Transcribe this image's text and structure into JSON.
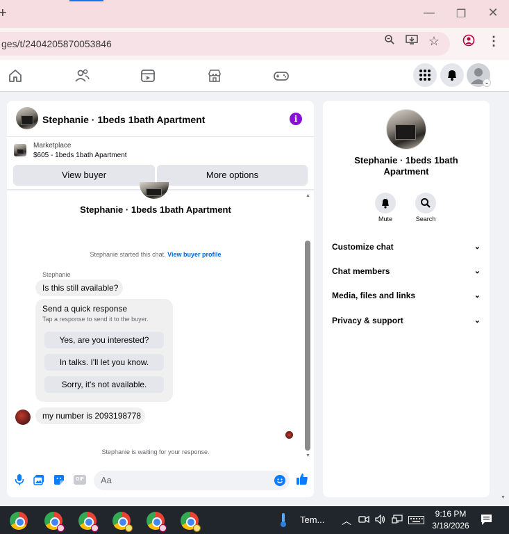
{
  "browser": {
    "url": "ges/t/2404205870053846",
    "new_tab_glyph": "+"
  },
  "chat": {
    "header_title": "Stephanie · 1beds 1bath Apartment",
    "marketplace_label": "Marketplace",
    "listing_line": "$605 - 1beds 1bath Apartment",
    "view_buyer": "View buyer",
    "more_options": "More options",
    "center_title": "Stephanie · 1beds 1bath Apartment",
    "started_text": "Stephanie started this chat.",
    "view_buyer_profile": "View buyer profile",
    "sender_name": "Stephanie",
    "first_message": "Is this still available?",
    "quick_title": "Send a quick response",
    "quick_subtitle": "Tap a response to send it to the buyer.",
    "quick_responses": [
      "Yes, are you interested?",
      "In talks. I'll let you know.",
      "Sorry, it's not available."
    ],
    "second_message": "my number is 2093198778",
    "waiting_text": "Stephanie is waiting for your response.",
    "composer_placeholder": "Aa"
  },
  "info": {
    "name": "Stephanie · 1beds 1bath Apartment",
    "mute": "Mute",
    "search": "Search",
    "sections": [
      "Customize chat",
      "Chat members",
      "Media, files and links",
      "Privacy & support"
    ]
  },
  "taskbar": {
    "weather": "Tem...",
    "time": "9:16 PM",
    "date": "3/18/2026"
  },
  "colors": {
    "accent": "#0064d1",
    "messenger_blue": "#0a7cff",
    "info_purple": "#8a0fd6"
  }
}
